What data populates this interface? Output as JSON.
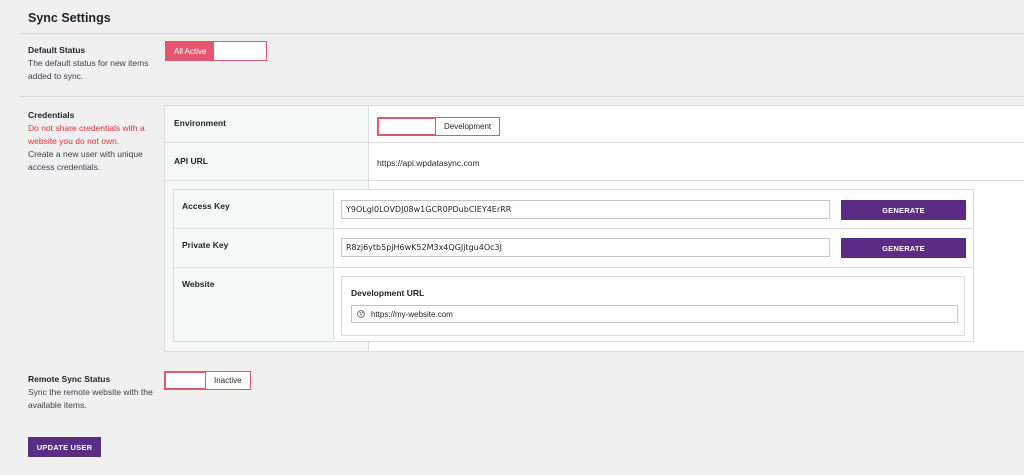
{
  "page": {
    "title": "Sync Settings"
  },
  "default_status": {
    "label": "Default Status",
    "description": "The default status for new items added to sync.",
    "toggle_text": "All Active"
  },
  "credentials": {
    "label": "Credentials",
    "warning": "Do not share credentials with a website you do not own.",
    "description": "Create a new user with unique access credentials.",
    "environment_label": "Environment",
    "environment_value": "Development",
    "api_url_label": "API URL",
    "api_url_value": "https://api.wpdatasync.com",
    "access_key_label": "Access Key",
    "access_key_value": "Y9OLgl0LOVDJ08w1GCR0PDubCIEY4ErRR",
    "private_key_label": "Private Key",
    "private_key_value": "R8zj6ytb5pjH6wK52M3x4QGJjtgu4Oc3J",
    "generate_label": "GENERATE",
    "website_label": "Website",
    "dev_url_label": "Development URL",
    "dev_url_value": "https://my-website.com"
  },
  "remote_sync": {
    "label": "Remote Sync Status",
    "description": "Sync the remote website with the available items.",
    "toggle_text": "Inactive"
  },
  "update_button": "UPDATE USER",
  "colors": {
    "accent": "#e2576f",
    "button": "#5b2c83",
    "warning": "#d63638"
  },
  "icons": {
    "url_icon": "globe-icon"
  }
}
